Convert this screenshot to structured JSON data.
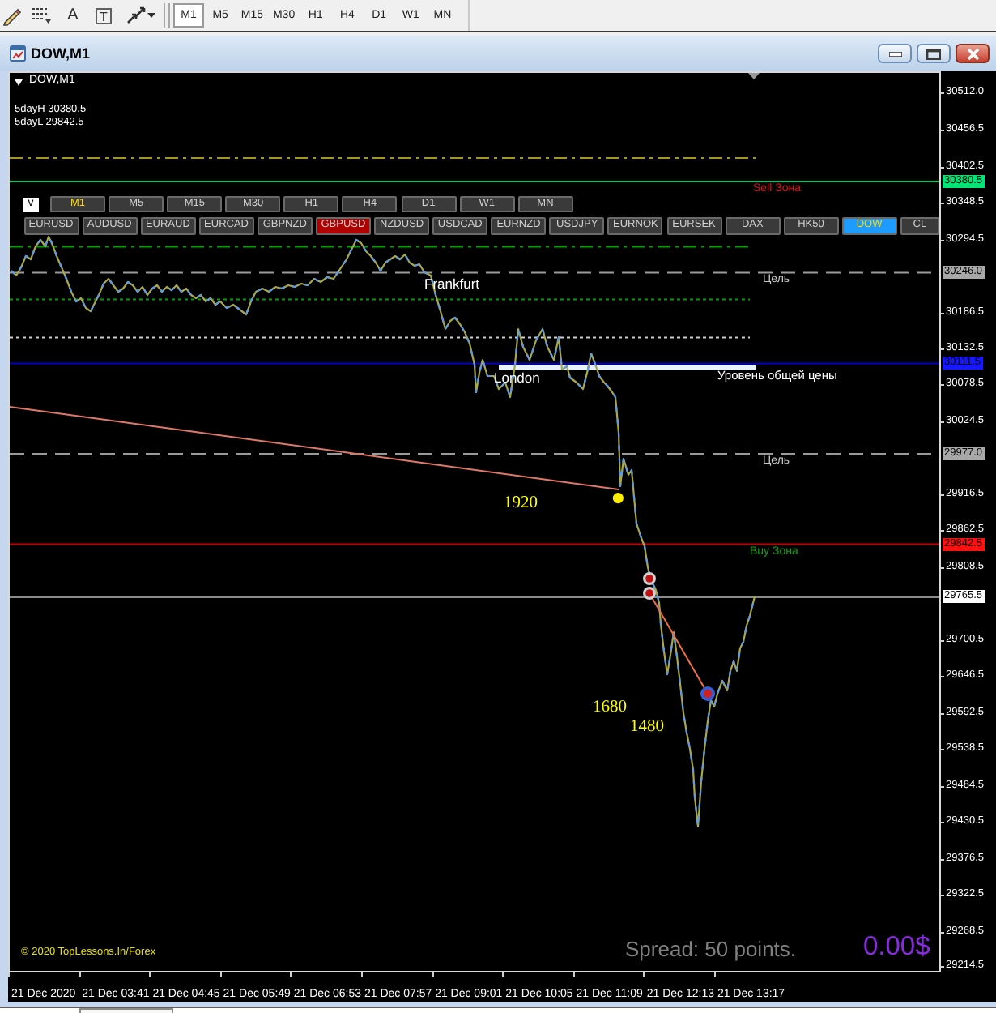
{
  "toolbar": {
    "text_tool": "A",
    "label_tool": "T",
    "timeframes": [
      {
        "label": "M1",
        "selected": true
      },
      {
        "label": "M5",
        "selected": false
      },
      {
        "label": "M15",
        "selected": false
      },
      {
        "label": "M30",
        "selected": false
      },
      {
        "label": "H1",
        "selected": false
      },
      {
        "label": "H4",
        "selected": false
      },
      {
        "label": "D1",
        "selected": false
      },
      {
        "label": "W1",
        "selected": false
      },
      {
        "label": "MN",
        "selected": false
      }
    ]
  },
  "window": {
    "title": "DOW,M1"
  },
  "chart": {
    "symbol": "DOW,M1",
    "info": [
      "5dayH 30380.5",
      "5dayL 29842.5"
    ],
    "panel_toggle": "v",
    "timeframes": [
      {
        "label": "M1",
        "selected": true
      },
      {
        "label": "M5",
        "selected": false
      },
      {
        "label": "M15",
        "selected": false
      },
      {
        "label": "M30",
        "selected": false
      },
      {
        "label": "H1",
        "selected": false
      },
      {
        "label": "H4",
        "selected": false
      },
      {
        "label": "D1",
        "selected": false
      },
      {
        "label": "W1",
        "selected": false
      },
      {
        "label": "MN",
        "selected": false
      }
    ],
    "symbols": [
      {
        "label": "EURUSD",
        "selected": false,
        "color": "#3a3a3a"
      },
      {
        "label": "AUDUSD",
        "selected": false,
        "color": "#3a3a3a"
      },
      {
        "label": "EURAUD",
        "selected": false,
        "color": "#3a3a3a"
      },
      {
        "label": "EURCAD",
        "selected": false,
        "color": "#3a3a3a"
      },
      {
        "label": "GBPNZD",
        "selected": false,
        "color": "#3a3a3a"
      },
      {
        "label": "GBPUSD",
        "selected": false,
        "color": "#b00000"
      },
      {
        "label": "NZDUSD",
        "selected": false,
        "color": "#3a3a3a"
      },
      {
        "label": "USDCAD",
        "selected": false,
        "color": "#3a3a3a"
      },
      {
        "label": "EURNZD",
        "selected": false,
        "color": "#3a3a3a"
      },
      {
        "label": "USDJPY",
        "selected": false,
        "color": "#3a3a3a"
      },
      {
        "label": "EURNOK",
        "selected": false,
        "color": "#3a3a3a"
      },
      {
        "label": "EURSEK",
        "selected": false,
        "color": "#3a3a3a"
      },
      {
        "label": "DAX",
        "selected": false,
        "color": "#3a3a3a"
      },
      {
        "label": "HK50",
        "selected": false,
        "color": "#3a3a3a"
      },
      {
        "label": "DOW",
        "selected": true,
        "color": "#1e9bff"
      },
      {
        "label": "CL",
        "selected": false,
        "color": "#3a3a3a"
      }
    ],
    "labels": [
      {
        "text": "Sell Зона",
        "color": "#e01010"
      },
      {
        "text": "Frankfurt",
        "color": "#ffffff"
      },
      {
        "text": "Цель",
        "color": "#c8c8c8"
      },
      {
        "text": "London",
        "color": "#ffffff"
      },
      {
        "text": "Уровень общей цены",
        "color": "#ffffff"
      },
      {
        "text": "Цель",
        "color": "#c8c8c8"
      },
      {
        "text": "1920",
        "color": "#ffff00"
      },
      {
        "text": "Buy Зона",
        "color": "#10a010"
      },
      {
        "text": "1680",
        "color": "#ffff00"
      },
      {
        "text": "1480",
        "color": "#ffff00"
      },
      {
        "text": "© 2020 TopLessons.In/Forex",
        "color": "#e8e000"
      },
      {
        "text": "Spread: 50 points.",
        "color": "#808080"
      },
      {
        "text": "0.00$",
        "color": "#8a2be2"
      }
    ]
  },
  "price_axis": {
    "labels": [
      {
        "text": "30512.0",
        "kind": "tick"
      },
      {
        "text": "30456.5",
        "kind": "tick"
      },
      {
        "text": "30402.5",
        "kind": "tick"
      },
      {
        "text": "30380.5",
        "kind": "tag",
        "color": "#00e676"
      },
      {
        "text": "30348.5",
        "kind": "tick"
      },
      {
        "text": "30294.5",
        "kind": "tick"
      },
      {
        "text": "30246.0",
        "kind": "tag",
        "color": "#a8a8a8"
      },
      {
        "text": "30186.5",
        "kind": "tick"
      },
      {
        "text": "30132.5",
        "kind": "tick"
      },
      {
        "text": "30111.5",
        "kind": "tag",
        "color": "#1818ff"
      },
      {
        "text": "30078.5",
        "kind": "tick"
      },
      {
        "text": "30024.5",
        "kind": "tick"
      },
      {
        "text": "29977.0",
        "kind": "tag",
        "color": "#a8a8a8"
      },
      {
        "text": "29916.5",
        "kind": "tick"
      },
      {
        "text": "29862.5",
        "kind": "tick"
      },
      {
        "text": "29842.5",
        "kind": "tag",
        "color": "#ff1010"
      },
      {
        "text": "29808.5",
        "kind": "tick"
      },
      {
        "text": "29765.5",
        "kind": "tag",
        "color": "#ffffff"
      },
      {
        "text": "29700.5",
        "kind": "tick"
      },
      {
        "text": "29646.5",
        "kind": "tick"
      },
      {
        "text": "29592.5",
        "kind": "tick"
      },
      {
        "text": "29538.5",
        "kind": "tick"
      },
      {
        "text": "29484.5",
        "kind": "tick"
      },
      {
        "text": "29430.5",
        "kind": "tick"
      },
      {
        "text": "29376.5",
        "kind": "tick"
      },
      {
        "text": "29322.5",
        "kind": "tick"
      },
      {
        "text": "29268.5",
        "kind": "tick"
      },
      {
        "text": "29214.5",
        "kind": "tick"
      }
    ]
  },
  "time_axis": {
    "labels": [
      "21 Dec 2020",
      "21 Dec 03:41",
      "21 Dec 04:45",
      "21 Dec 05:49",
      "21 Dec 06:53",
      "21 Dec 07:57",
      "21 Dec 09:01",
      "21 Dec 10:05",
      "21 Dec 11:09",
      "21 Dec 12:13",
      "21 Dec 13:17"
    ]
  }
}
